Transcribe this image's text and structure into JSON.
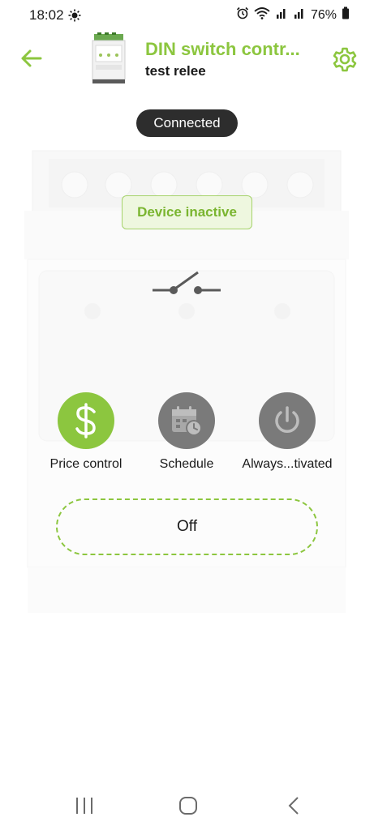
{
  "status_bar": {
    "time": "18:02",
    "battery_percent": "76%"
  },
  "header": {
    "title": "DIN switch contr...",
    "subtitle": "test relee"
  },
  "connection_status": "Connected",
  "device_state_badge": "Device inactive",
  "modes": [
    {
      "label": "Price control",
      "icon": "dollar-icon",
      "active": true
    },
    {
      "label": "Schedule",
      "icon": "calendar-clock-icon",
      "active": false
    },
    {
      "label": "Always...tivated",
      "icon": "power-icon",
      "active": false
    }
  ],
  "state_button_label": "Off",
  "colors": {
    "accent": "#8cc63f",
    "inactive_mode": "#7a7a7a",
    "pill_bg": "#2d2d2d"
  }
}
